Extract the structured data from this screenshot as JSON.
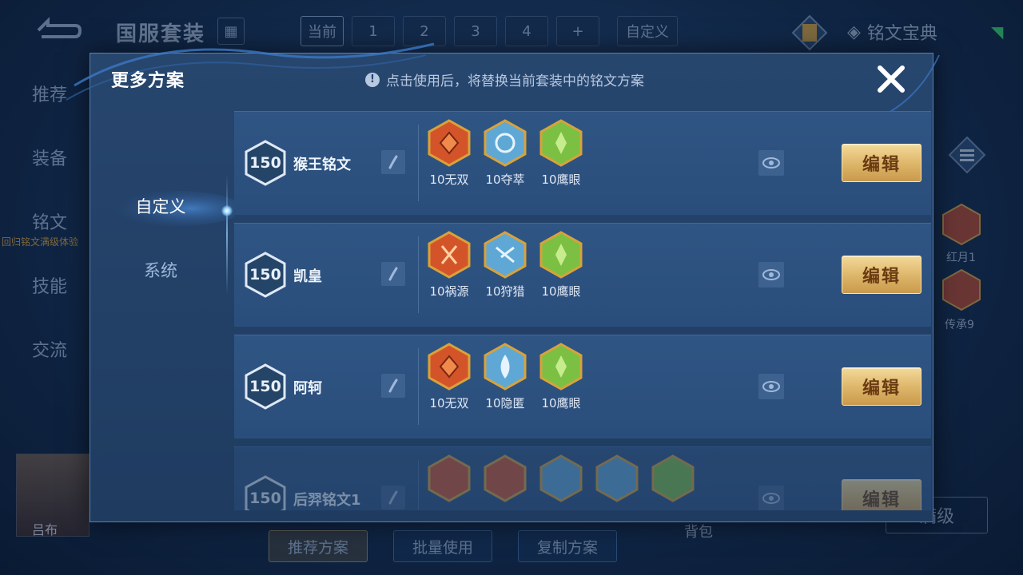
{
  "background": {
    "title": "国服套装",
    "tabs": [
      "当前",
      "1",
      "2",
      "3",
      "4",
      "+",
      "自定义"
    ],
    "dictionary_label": "铭文宝典",
    "side_items": [
      "推荐",
      "装备",
      "铭文",
      "技能",
      "交流"
    ],
    "side_sub_note": "回归铭文满级体验",
    "hero_name": "吕布",
    "bottom_buttons": [
      "推荐方案",
      "批量使用",
      "复制方案"
    ],
    "right_runes": [
      "红月1",
      "传承9"
    ],
    "max_label": "满级",
    "pack_label": "背包"
  },
  "modal": {
    "title": "更多方案",
    "hint": "点击使用后，将替换当前套装中的铭文方案",
    "side_tabs": [
      "自定义",
      "系统"
    ],
    "edit_label": "编辑",
    "rows": [
      {
        "level": "150",
        "name": "猴王铭文",
        "runes": [
          {
            "label": "10无双",
            "color": "red"
          },
          {
            "label": "10夺萃",
            "color": "blue"
          },
          {
            "label": "10鹰眼",
            "color": "green"
          }
        ]
      },
      {
        "level": "150",
        "name": "凯皇",
        "runes": [
          {
            "label": "10祸源",
            "color": "red"
          },
          {
            "label": "10狩猎",
            "color": "blue"
          },
          {
            "label": "10鹰眼",
            "color": "green"
          }
        ]
      },
      {
        "level": "150",
        "name": "阿轲",
        "runes": [
          {
            "label": "10无双",
            "color": "red"
          },
          {
            "label": "10隐匿",
            "color": "blue"
          },
          {
            "label": "10鹰眼",
            "color": "green"
          }
        ]
      },
      {
        "level": "150",
        "name": "后羿铭文1",
        "runes": [
          {
            "label": "",
            "color": "red"
          },
          {
            "label": "",
            "color": "red"
          },
          {
            "label": "",
            "color": "blue"
          },
          {
            "label": "",
            "color": "blue"
          },
          {
            "label": "",
            "color": "green"
          }
        ]
      }
    ]
  },
  "colors": {
    "red": "#d4542a",
    "blue": "#5fa8d6",
    "green": "#7cc043",
    "gold": "#dcb468"
  }
}
